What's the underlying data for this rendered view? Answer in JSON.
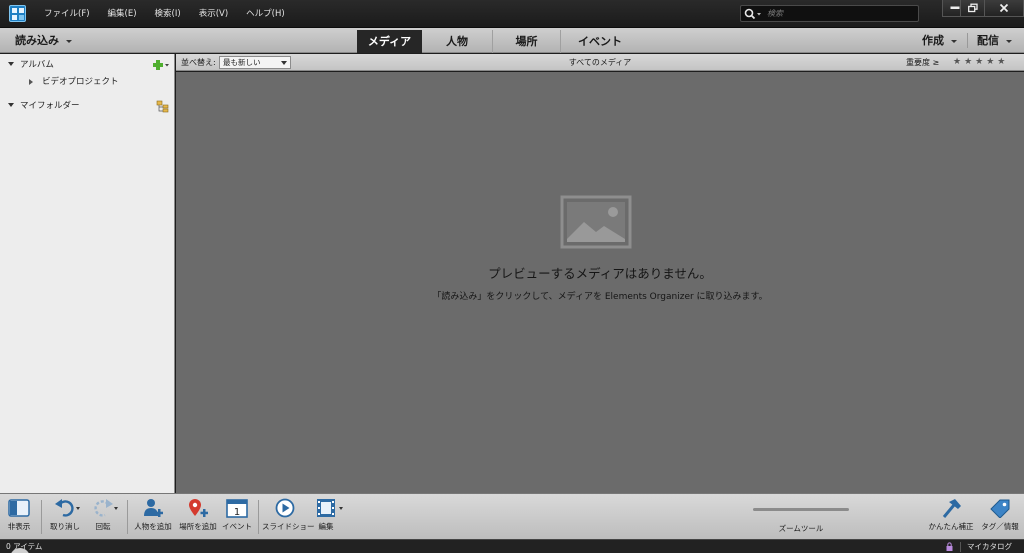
{
  "window": {
    "menu": [
      "ファイル(F)",
      "編集(E)",
      "検索(I)",
      "表示(V)",
      "ヘルプ(H)"
    ],
    "search_placeholder": "検索"
  },
  "tabbar": {
    "import_label": "読み込み",
    "tabs": [
      "メディア",
      "人物",
      "場所",
      "イベント"
    ],
    "active_tab": "メディア",
    "create_label": "作成",
    "share_label": "配信"
  },
  "sidebar": {
    "albums_label": "アルバム",
    "album_items": [
      "ビデオプロジェクト"
    ],
    "folders_label": "マイフォルダー"
  },
  "grid_toolbar": {
    "sort_label": "並べ替え:",
    "sort_value": "最も新しい",
    "title": "すべてのメディア",
    "rating_label": "重要度 ≥",
    "stars": "★★★★★"
  },
  "main": {
    "empty_title": "プレビューするメディアはありません。",
    "empty_subtitle": "「読み込み」をクリックして、メディアを Elements Organizer に取り込みます。"
  },
  "bottom_toolbar": {
    "hide_panel": "非表示",
    "undo": "取り消し",
    "rotate": "回転",
    "add_people": "人物を追加",
    "add_place": "場所を追加",
    "event": "イベント",
    "slideshow": "スライドショー",
    "edit": "編集",
    "zoom": "ズームツール",
    "instant_fix": "かんたん補正",
    "tags_info": "タグ／情報"
  },
  "status": {
    "count": "0 アイテム",
    "catalog": "マイカタログ"
  },
  "colors": {
    "brand_blue": "#1e7fc3",
    "main_background": "#6b6b6b",
    "active_tab": "#262626"
  }
}
